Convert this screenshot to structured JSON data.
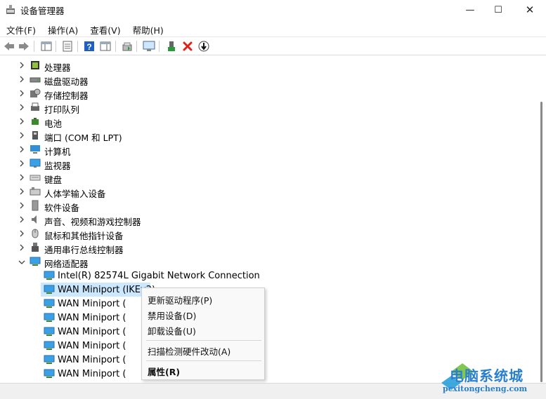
{
  "window": {
    "title": "设备管理器",
    "minimize_glyph": "—",
    "maximize_glyph": "☐",
    "close_glyph": "✕"
  },
  "menubar": [
    {
      "label": "文件(F)"
    },
    {
      "label": "操作(A)"
    },
    {
      "label": "查看(V)"
    },
    {
      "label": "帮助(H)"
    }
  ],
  "toolbar": {
    "buttons": [
      "back-icon",
      "forward-icon",
      "show-hide-tree-icon",
      "properties-icon",
      "help-icon",
      "action-pane-icon",
      "update-driver-icon",
      "scan-hardware-icon",
      "enable-device-icon",
      "uninstall-icon",
      "disable-device-icon"
    ]
  },
  "tree": {
    "categories": [
      {
        "label": "处理器",
        "icon": "processor-icon"
      },
      {
        "label": "磁盘驱动器",
        "icon": "disk-drive-icon"
      },
      {
        "label": "存储控制器",
        "icon": "storage-controller-icon"
      },
      {
        "label": "打印队列",
        "icon": "print-queue-icon"
      },
      {
        "label": "电池",
        "icon": "battery-icon"
      },
      {
        "label": "端口 (COM 和 LPT)",
        "icon": "port-icon"
      },
      {
        "label": "计算机",
        "icon": "computer-icon"
      },
      {
        "label": "监视器",
        "icon": "monitor-icon"
      },
      {
        "label": "键盘",
        "icon": "keyboard-icon"
      },
      {
        "label": "人体学输入设备",
        "icon": "hid-icon"
      },
      {
        "label": "软件设备",
        "icon": "software-device-icon"
      },
      {
        "label": "声音、视频和游戏控制器",
        "icon": "sound-icon"
      },
      {
        "label": "鼠标和其他指针设备",
        "icon": "mouse-icon"
      },
      {
        "label": "通用串行总线控制器",
        "icon": "usb-icon"
      },
      {
        "label": "网络适配器",
        "icon": "network-adapter-icon",
        "expanded": true
      }
    ],
    "network_children": [
      {
        "label": "Intel(R) 82574L Gigabit Network Connection"
      },
      {
        "label": "WAN Miniport (IKEv2)",
        "selected": true
      },
      {
        "label": "WAN Miniport ("
      },
      {
        "label": "WAN Miniport ("
      },
      {
        "label": "WAN Miniport ("
      },
      {
        "label": "WAN Miniport ("
      },
      {
        "label": "WAN Miniport ("
      },
      {
        "label": "WAN Miniport ("
      }
    ]
  },
  "context_menu": {
    "items": [
      {
        "label": "更新驱动程序(P)"
      },
      {
        "label": "禁用设备(D)"
      },
      {
        "label": "卸载设备(U)"
      },
      {
        "label": "扫描检测硬件改动(A)"
      },
      {
        "label": "属性(R)",
        "bold": true
      }
    ]
  },
  "watermark": {
    "title": "电脑系统城",
    "url": "pcxitongcheng.com"
  },
  "colors": {
    "selection": "#cce8ff",
    "accent": "#2a7fce",
    "close_red": "#e0201b"
  }
}
